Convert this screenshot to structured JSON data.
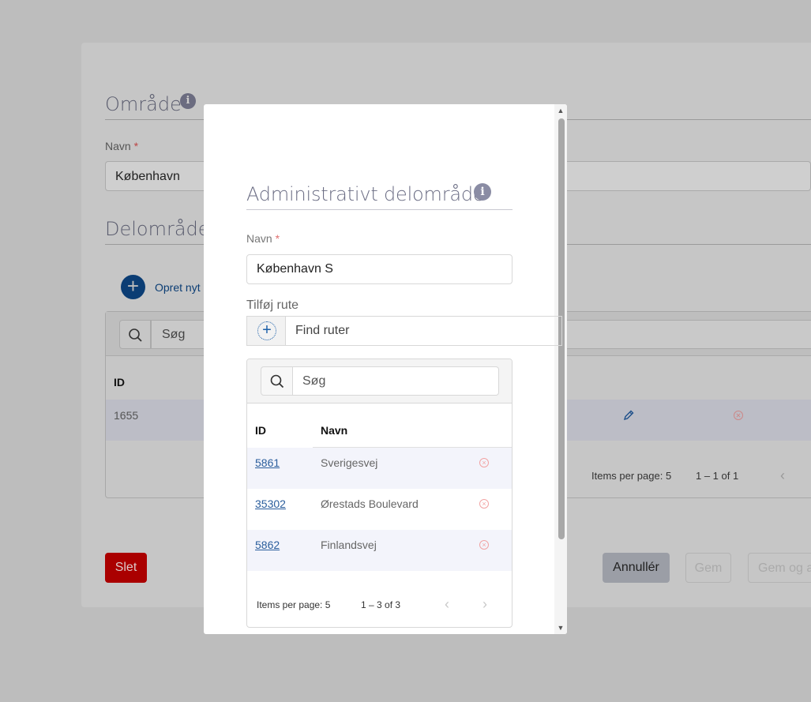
{
  "background": {
    "area_title": "Område",
    "name_label": "Navn",
    "required_mark": "*",
    "name_value": "København",
    "subarea_title": "Delområde",
    "create_new_label": "Opret nyt",
    "search_placeholder": "Søg",
    "table": {
      "col_id": "ID",
      "row_id": "1655"
    },
    "pagination": {
      "items_per_page_label": "Items per page:",
      "items_per_page_value": "5",
      "range": "1 – 1 of 1"
    },
    "buttons": {
      "delete": "Slet",
      "cancel": "Annullér",
      "save": "Gem",
      "save_and": "Gem og a"
    }
  },
  "modal": {
    "title": "Administrativt delområde",
    "name_label": "Navn",
    "required_mark": "*",
    "name_value": "København S",
    "add_route_label": "Tilføj rute",
    "find_routes_placeholder": "Find ruter",
    "search_placeholder": "Søg",
    "table": {
      "col_id": "ID",
      "col_name": "Navn",
      "rows": [
        {
          "id": "5861",
          "name": "Sverigesvej"
        },
        {
          "id": "35302",
          "name": "Ørestads Boulevard"
        },
        {
          "id": "5862",
          "name": "Finlandsvej"
        }
      ]
    },
    "pagination": {
      "items_per_page_label": "Items per page:",
      "items_per_page_value": "5",
      "range": "1 – 3 of 3"
    }
  }
}
